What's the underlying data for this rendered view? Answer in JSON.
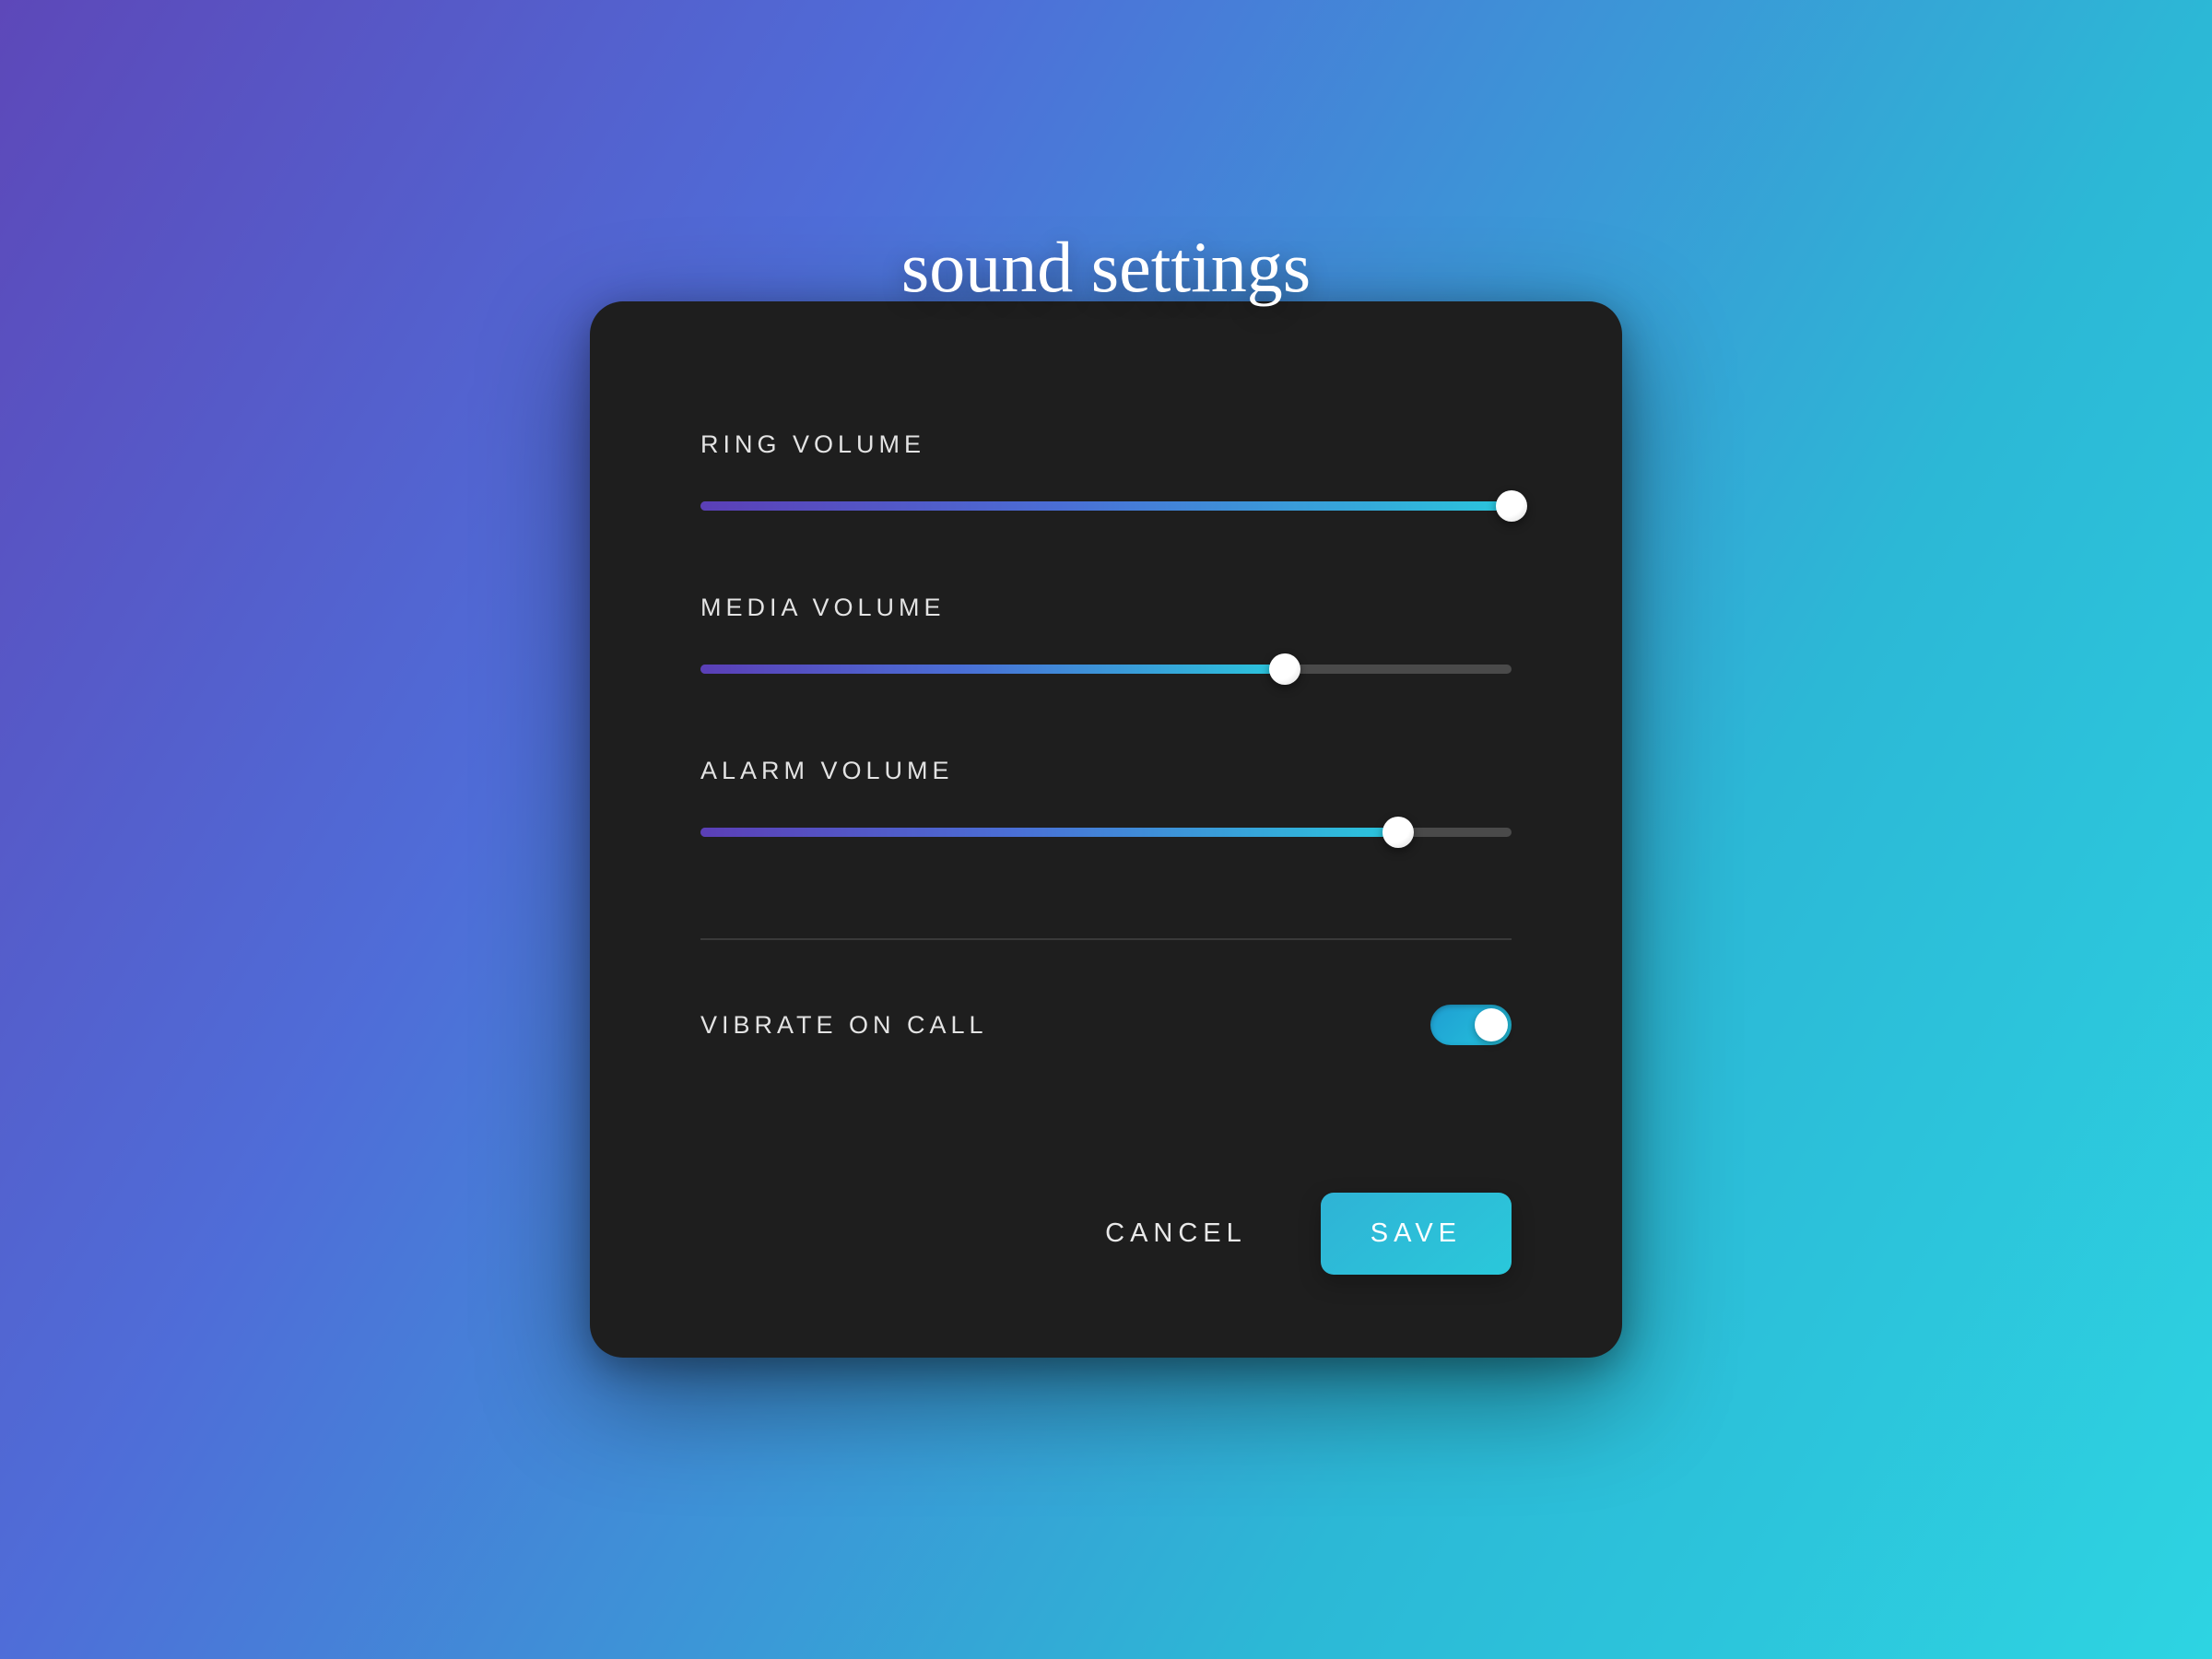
{
  "title": "sound settings",
  "sliders": [
    {
      "label": "RING VOLUME",
      "value_percent": 100
    },
    {
      "label": "MEDIA VOLUME",
      "value_percent": 72
    },
    {
      "label": "ALARM VOLUME",
      "value_percent": 86
    }
  ],
  "toggle": {
    "label": "VIBRATE ON CALL",
    "on": true
  },
  "actions": {
    "cancel_label": "CANCEL",
    "save_label": "SAVE"
  },
  "colors": {
    "card_bg": "#1e1e1e",
    "accent_start": "#5b3fb7",
    "accent_end": "#2ac6dc"
  }
}
